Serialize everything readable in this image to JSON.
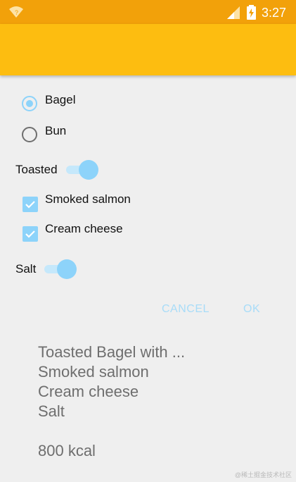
{
  "status_bar": {
    "time": "3:27",
    "color": "#f2a10a"
  },
  "app_bar": {
    "color": "#fdbd10"
  },
  "bread_options": [
    {
      "label": "Bagel",
      "checked": true
    },
    {
      "label": "Bun",
      "checked": false
    }
  ],
  "toasted": {
    "label": "Toasted",
    "on": true
  },
  "toppings": [
    {
      "label": "Smoked salmon",
      "checked": true
    },
    {
      "label": "Cream cheese",
      "checked": true
    }
  ],
  "salt": {
    "label": "Salt",
    "on": true
  },
  "dialog": {
    "cancel": "CANCEL",
    "ok": "OK"
  },
  "summary": {
    "line1": "Toasted Bagel with ...",
    "line2": "Smoked salmon",
    "line3": "Cream cheese",
    "line4": "Salt",
    "calories": "800 kcal"
  },
  "watermark": "@稀土掘金技术社区",
  "accent_color": "#8dd3fa"
}
